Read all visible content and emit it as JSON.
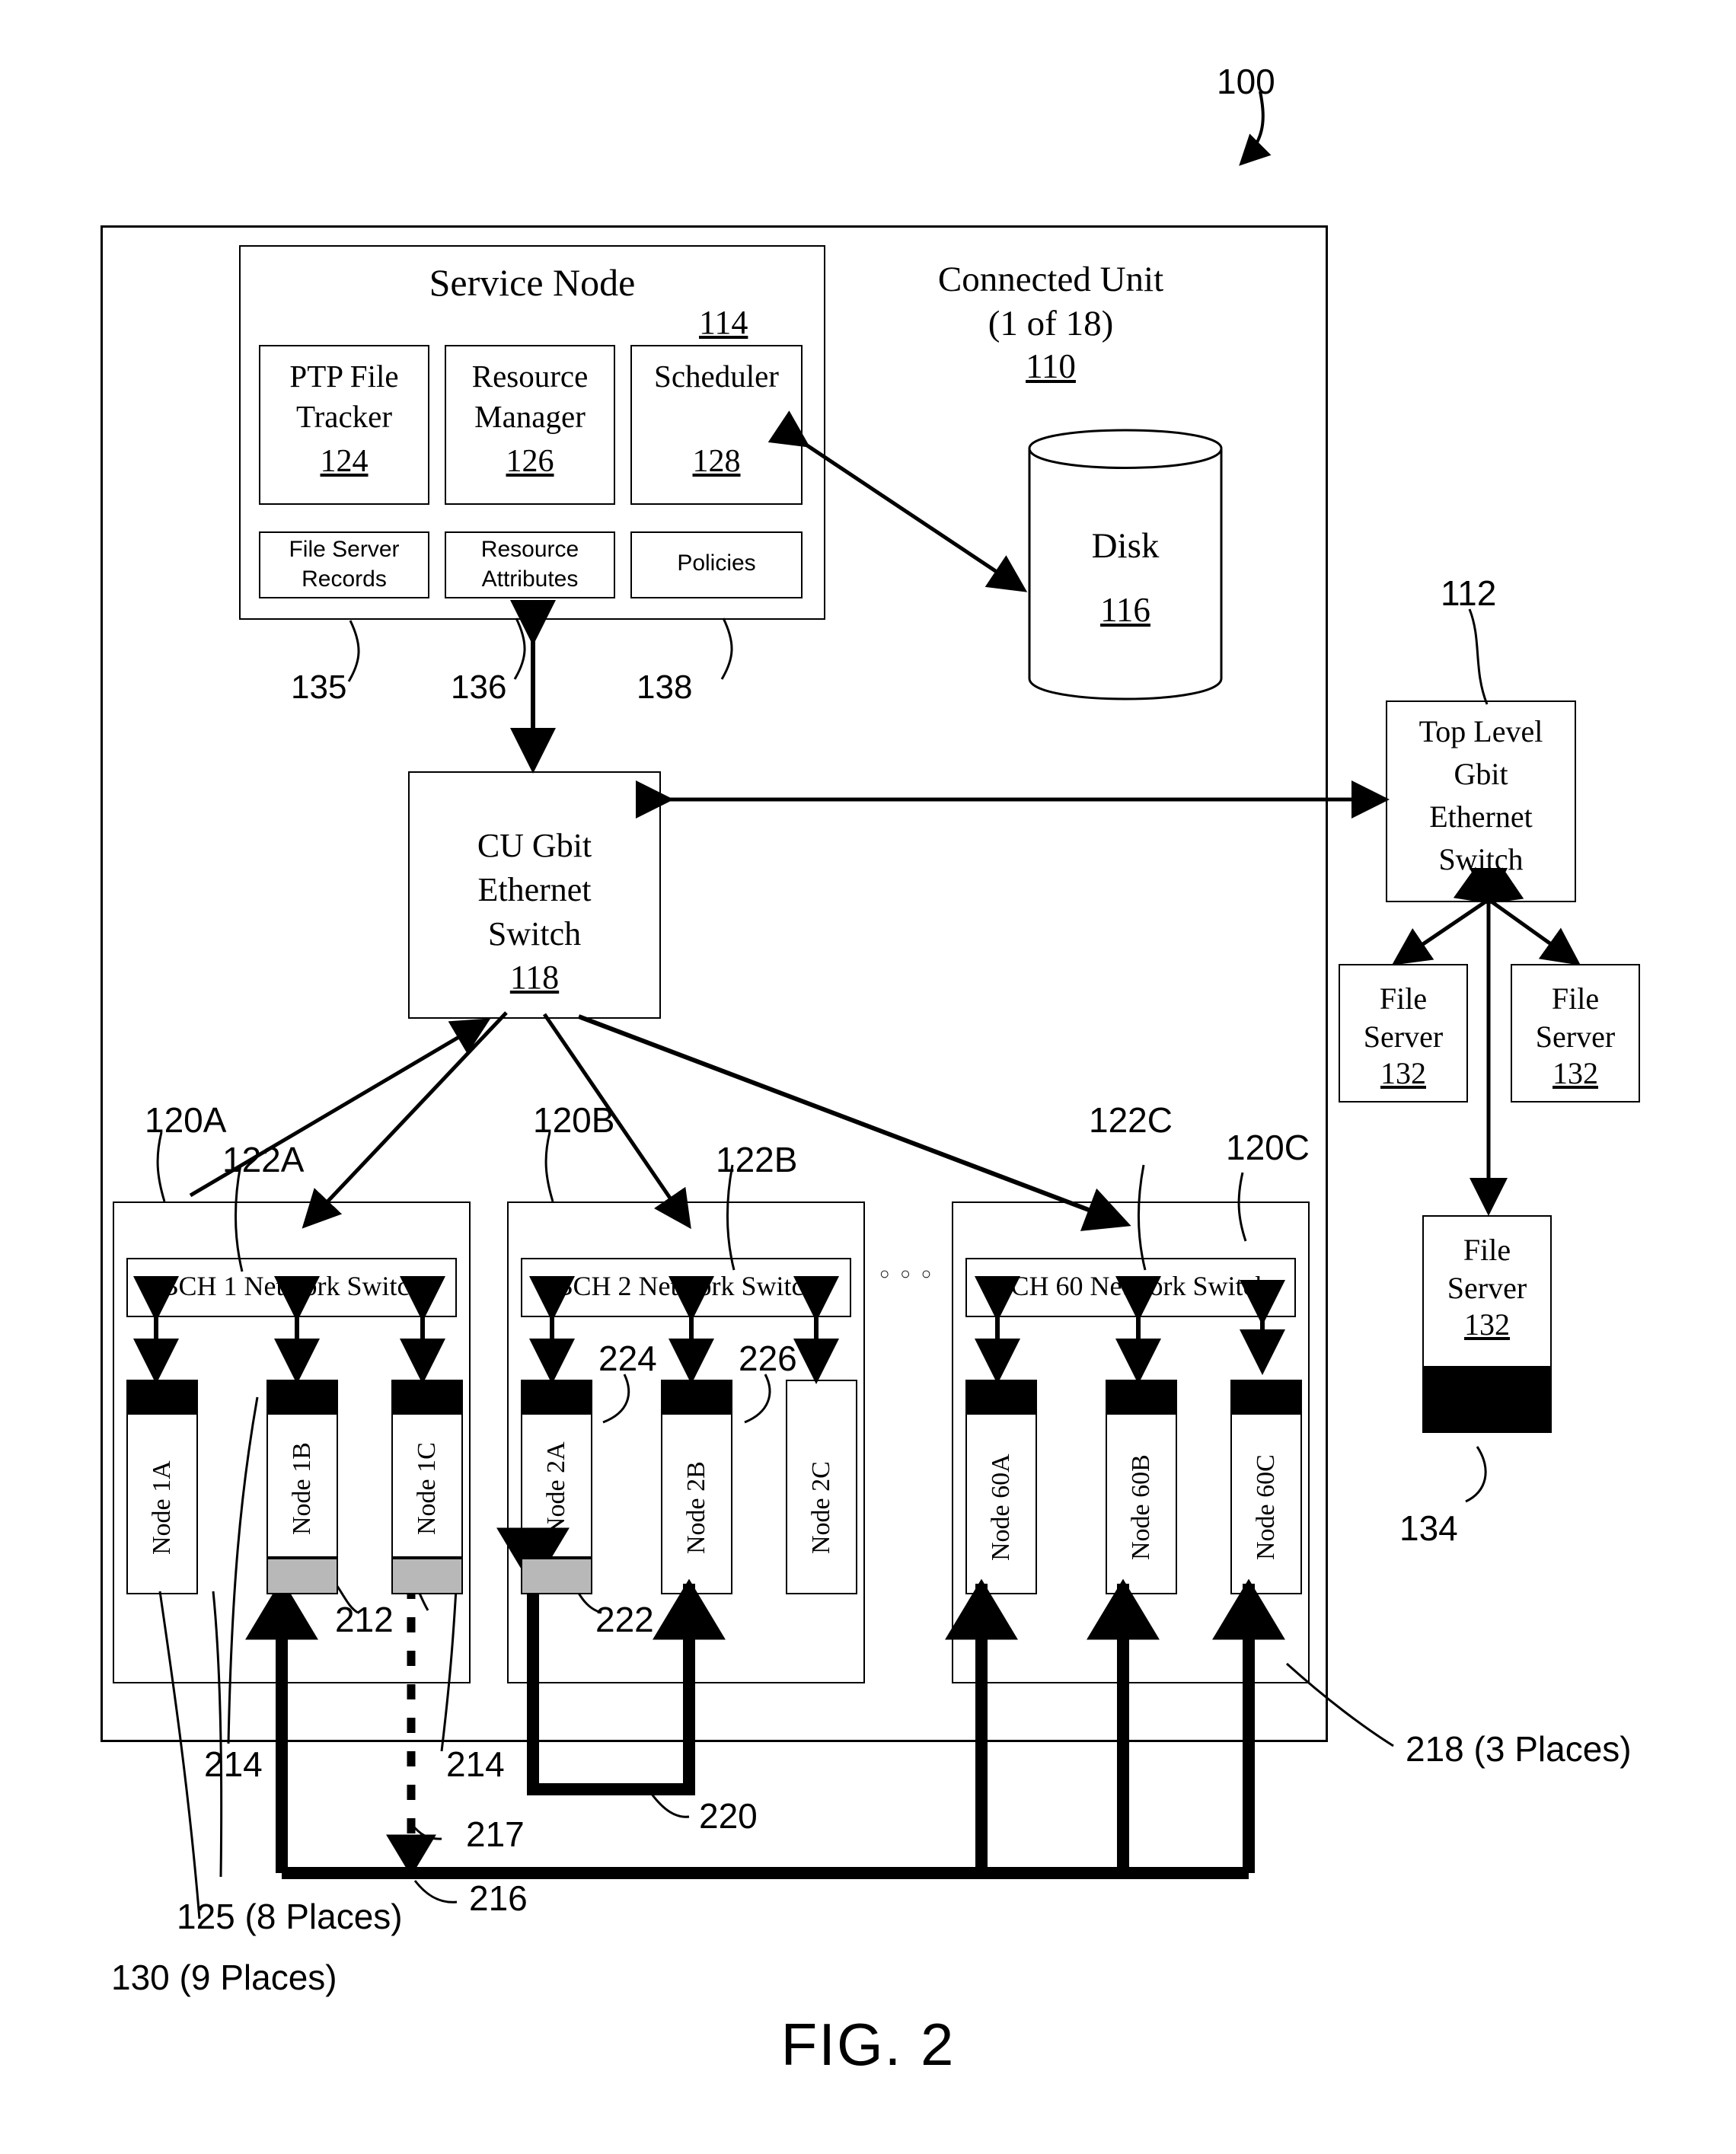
{
  "figure": {
    "caption": "FIG. 2",
    "system_ref": "100"
  },
  "connected_unit": {
    "title_line1": "Connected Unit",
    "title_line2": "(1 of 18)",
    "ref": "110"
  },
  "service_node": {
    "title": "Service Node",
    "ref": "114",
    "modules": [
      {
        "name_line1": "PTP File",
        "name_line2": "Tracker",
        "ref": "124"
      },
      {
        "name_line1": "Resource",
        "name_line2": "Manager",
        "ref": "126"
      },
      {
        "name_line1": "Scheduler",
        "name_line2": "",
        "ref": "128"
      }
    ],
    "stores": [
      {
        "line1": "File Server",
        "line2": "Records",
        "ref": "135"
      },
      {
        "line1": "Resource",
        "line2": "Attributes",
        "ref": "136"
      },
      {
        "line1": "Policies",
        "line2": "",
        "ref": "138"
      }
    ]
  },
  "disk": {
    "label": "Disk",
    "ref": "116"
  },
  "cu_switch": {
    "line1": "CU Gbit",
    "line2": "Ethernet",
    "line3": "Switch",
    "ref": "118"
  },
  "top_switch": {
    "line1": "Top Level",
    "line2": "Gbit",
    "line3": "Ethernet",
    "line4": "Switch",
    "ref": "112"
  },
  "file_servers": [
    {
      "line1": "File",
      "line2": "Server",
      "ref": "132"
    },
    {
      "line1": "File",
      "line2": "Server",
      "ref": "132"
    },
    {
      "line1": "File",
      "line2": "Server",
      "ref": "132"
    }
  ],
  "file_server_bar_ref": "134",
  "bch_groups": [
    {
      "switch_label": "BCH 1 Network Switch",
      "group_ref": "120A",
      "switch_ref": "122A",
      "nodes": [
        {
          "label": "Node 1A",
          "has_black_cap": true,
          "has_grey_cap": false
        },
        {
          "label": "Node 1B",
          "has_black_cap": true,
          "has_grey_cap": true
        },
        {
          "label": "Node 1C",
          "has_black_cap": true,
          "has_grey_cap": true
        }
      ]
    },
    {
      "switch_label": "BCH 2 Network Switch",
      "group_ref": "120B",
      "switch_ref": "122B",
      "nodes": [
        {
          "label": "Node 2A",
          "has_black_cap": true,
          "has_grey_cap": true
        },
        {
          "label": "Node 2B",
          "has_black_cap": true,
          "has_grey_cap": false
        },
        {
          "label": "Node 2C",
          "has_black_cap": false,
          "has_grey_cap": false
        }
      ]
    },
    {
      "switch_label": "BCH 60 Network Switch",
      "group_ref": "120C",
      "switch_ref": "122C",
      "nodes": [
        {
          "label": "Node 60A",
          "has_black_cap": true,
          "has_grey_cap": false
        },
        {
          "label": "Node 60B",
          "has_black_cap": true,
          "has_grey_cap": false
        },
        {
          "label": "Node 60C",
          "has_black_cap": true,
          "has_grey_cap": false
        }
      ]
    }
  ],
  "ellipsis": "○ ○ ○",
  "callouts": {
    "c212": "212",
    "c214_a": "214",
    "c214_b": "214",
    "c216": "216",
    "c217": "217",
    "c218": "218 (3 Places)",
    "c220": "220",
    "c222": "222",
    "c224": "224",
    "c226": "226",
    "c125": "125 (8 Places)",
    "c130": "130 (9 Places)"
  },
  "colors": {
    "line": "#000000",
    "grey_cap": "#b8b8b8",
    "background": "#ffffff"
  }
}
